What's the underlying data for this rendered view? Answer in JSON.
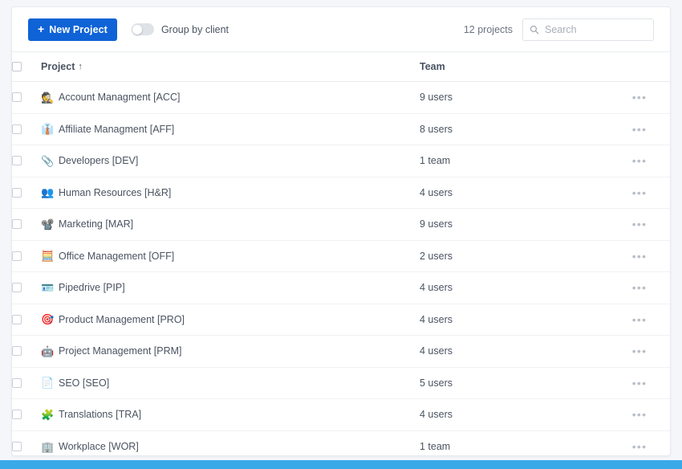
{
  "toolbar": {
    "new_project_label": "New Project",
    "new_project_icon": "plus-icon",
    "new_project_color": "#0f63d6",
    "group_by_client_label": "Group by client",
    "group_by_client_state": "off",
    "project_count": "12 projects",
    "search_placeholder": "Search",
    "search_value": "",
    "search_icon": "search-icon"
  },
  "table": {
    "columns": {
      "select_all": "",
      "project": "Project",
      "project_sort_indicator": "↑",
      "team": "Team",
      "actions": ""
    },
    "row_menu_glyph": "•••",
    "rows": [
      {
        "icon": "🕵️",
        "icon_name": "detective-icon",
        "name": "Account Managment [ACC]",
        "team": "9 users"
      },
      {
        "icon": "👔",
        "icon_name": "necktie-icon",
        "name": "Affiliate Managment [AFF]",
        "team": "8 users"
      },
      {
        "icon": "📎",
        "icon_name": "clipboard-icon",
        "name": "Developers [DEV]",
        "team": "1 team"
      },
      {
        "icon": "👥",
        "icon_name": "people-group-icon",
        "name": "Human Resources [H&R]",
        "team": "4 users"
      },
      {
        "icon": "📽️",
        "icon_name": "projector-globe-icon",
        "name": "Marketing [MAR]",
        "team": "9 users"
      },
      {
        "icon": "🧮",
        "icon_name": "calculator-icon",
        "name": "Office Management [OFF]",
        "team": "2 users"
      },
      {
        "icon": "🪪",
        "icon_name": "id-badge-icon",
        "name": "Pipedrive [PIP]",
        "team": "4 users"
      },
      {
        "icon": "🎯",
        "icon_name": "target-icon",
        "name": "Product Management [PRO]",
        "team": "4 users"
      },
      {
        "icon": "🤖",
        "icon_name": "robot-icon",
        "name": "Project Management [PRM]",
        "team": "4 users"
      },
      {
        "icon": "📄",
        "icon_name": "document-icon",
        "name": "SEO [SEO]",
        "team": "5 users"
      },
      {
        "icon": "🧩",
        "icon_name": "puzzle-icon",
        "name": "Translations [TRA]",
        "team": "4 users"
      },
      {
        "icon": "🏢",
        "icon_name": "office-building-icon",
        "name": "Workplace [WOR]",
        "team": "1 team"
      }
    ]
  },
  "bottom_bar": {
    "color": "#3aa9e8"
  }
}
